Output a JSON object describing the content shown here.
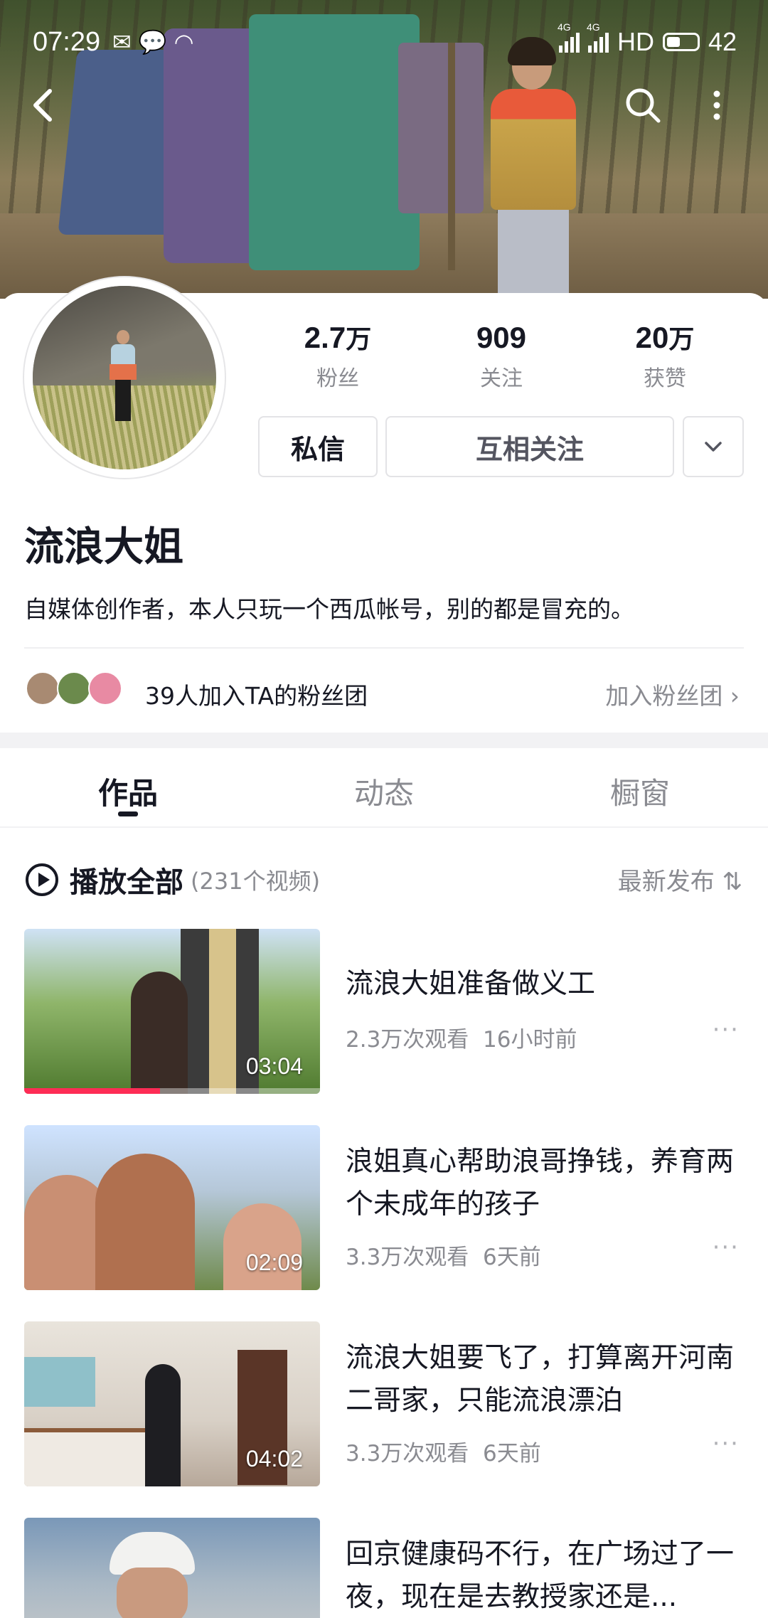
{
  "status_bar": {
    "time": "07:29",
    "net1": "4G",
    "net2": "4G",
    "hd": "HD",
    "battery": "42"
  },
  "nav": {
    "back_icon": "chevron-left-icon",
    "search_icon": "search-icon",
    "more_icon": "more-vertical-icon"
  },
  "profile": {
    "stats": [
      {
        "num": "2.7",
        "unit": "万",
        "label": "粉丝"
      },
      {
        "num": "909",
        "unit": "",
        "label": "关注"
      },
      {
        "num": "20",
        "unit": "万",
        "label": "获赞"
      }
    ],
    "message_label": "私信",
    "follow_label": "互相关注",
    "more_glyph": "⌄",
    "name": "流浪大姐",
    "bio": "自媒体创作者，本人只玩一个西瓜帐号，别的都是冒充的。",
    "fan_club_text": "39人加入TA的粉丝团",
    "fan_club_join": "加入粉丝团 ›"
  },
  "tabs": [
    {
      "label": "作品",
      "active": true
    },
    {
      "label": "动态",
      "active": false
    },
    {
      "label": "橱窗",
      "active": false
    }
  ],
  "list_header": {
    "play_all": "播放全部",
    "count": "(231个视频)",
    "sort": "最新发布 ⇅"
  },
  "videos": [
    {
      "title": "流浪大姐准备做义工",
      "views": "2.3万次观看",
      "time": "16小时前",
      "duration": "03:04",
      "progress": 0.46
    },
    {
      "title": "浪姐真心帮助浪哥挣钱，养育两个未成年的孩子",
      "views": "3.3万次观看",
      "time": "6天前",
      "duration": "02:09"
    },
    {
      "title": "流浪大姐要飞了，打算离开河南二哥家，只能流浪漂泊",
      "views": "3.3万次观看",
      "time": "6天前",
      "duration": "04:02"
    },
    {
      "title": "回京健康码不行，在广场过了一夜，现在是去教授家还是...",
      "views": "",
      "time": "",
      "duration": ""
    }
  ],
  "colors": {
    "accent": "#fe2c55",
    "text": "#161823",
    "secondary": "#8a8b91"
  }
}
